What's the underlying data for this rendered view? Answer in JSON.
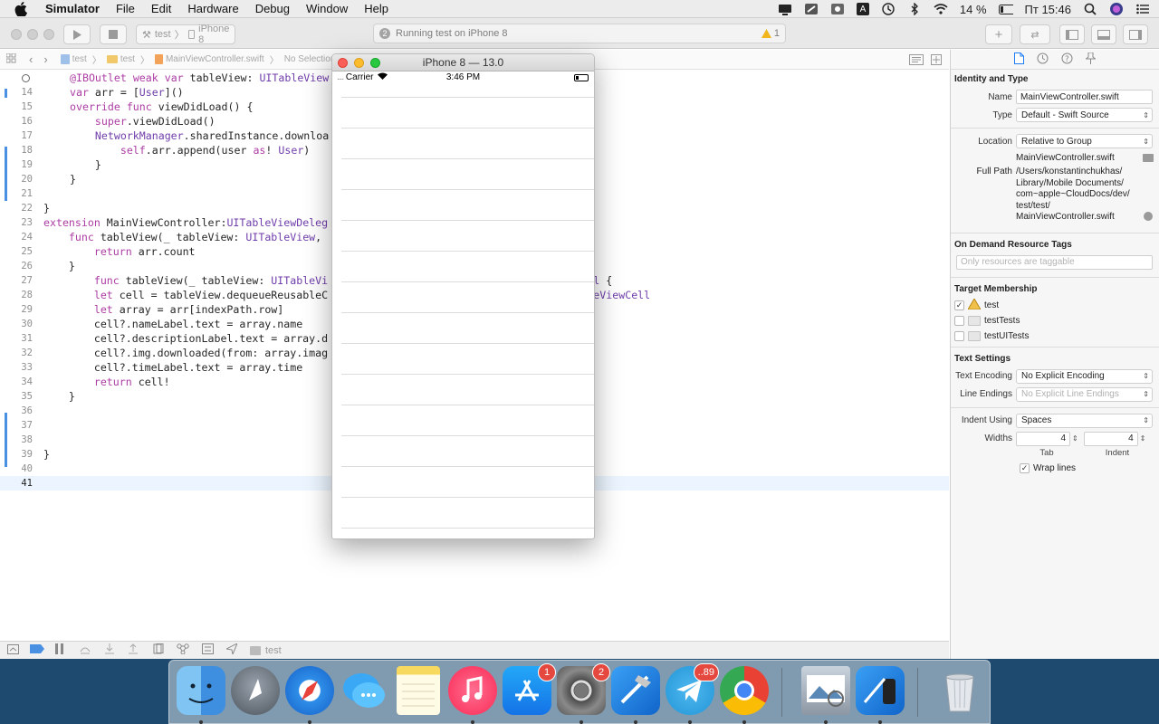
{
  "menubar": {
    "app_name": "Simulator",
    "items": [
      "File",
      "Edit",
      "Hardware",
      "Debug",
      "Window",
      "Help"
    ],
    "battery": "14 %",
    "clock": "Пт 15:46",
    "input_source": "A"
  },
  "toolbar": {
    "scheme_target": "test",
    "scheme_device": "iPhone 8",
    "activity_count": "2",
    "activity_text": "Running test on iPhone 8",
    "warning_count": "1"
  },
  "jumpbar": {
    "project": "test",
    "folder": "test",
    "file": "MainViewController.swift",
    "selection": "No Selection"
  },
  "editor": {
    "lines": [
      {
        "num": "",
        "code": "@IBOutlet weak var tableView: UITableView!"
      },
      {
        "num": "14",
        "code": "var arr = [User]()"
      },
      {
        "num": "15",
        "code": "override func viewDidLoad() {"
      },
      {
        "num": "16",
        "code": "    super.viewDidLoad()"
      },
      {
        "num": "17",
        "code": "    NetworkManager.sharedInstance.downloa"
      },
      {
        "num": "18",
        "code": "        self.arr.append(user as! User)"
      },
      {
        "num": "19",
        "code": "    }"
      },
      {
        "num": "20",
        "code": "}"
      },
      {
        "num": "21",
        "code": ""
      },
      {
        "num": "22",
        "code": "}"
      },
      {
        "num": "23",
        "code": "extension MainViewController:UITableViewDeleg"
      },
      {
        "num": "24",
        "code": "    func tableView(_ tableView: UITableView,                                 nt {"
      },
      {
        "num": "25",
        "code": "        return arr.count"
      },
      {
        "num": "26",
        "code": "    }"
      },
      {
        "num": "27",
        "code": "        func tableView(_ tableView: UITableVi                          > UITableViewCell {"
      },
      {
        "num": "28",
        "code": "        let cell = tableView.dequeueReusableC                          th) as? MainTableViewCell"
      },
      {
        "num": "29",
        "code": "        let array = arr[indexPath.row]"
      },
      {
        "num": "30",
        "code": "        cell?.nameLabel.text = array.name"
      },
      {
        "num": "31",
        "code": "        cell?.descriptionLabel.text = array.d"
      },
      {
        "num": "32",
        "code": "        cell?.img.downloaded(from: array.imag"
      },
      {
        "num": "33",
        "code": "        cell?.timeLabel.text = array.time"
      },
      {
        "num": "34",
        "code": "        return cell!"
      },
      {
        "num": "35",
        "code": "    }"
      },
      {
        "num": "36",
        "code": ""
      },
      {
        "num": "37",
        "code": ""
      },
      {
        "num": "38",
        "code": ""
      },
      {
        "num": "39",
        "code": "}"
      },
      {
        "num": "40",
        "code": ""
      },
      {
        "num": "41",
        "code": ""
      }
    ]
  },
  "debugbar": {
    "target": "test"
  },
  "inspector": {
    "identity_title": "Identity and Type",
    "name_label": "Name",
    "name_value": "MainViewController.swift",
    "type_label": "Type",
    "type_value": "Default - Swift Source",
    "location_label": "Location",
    "location_value": "Relative to Group",
    "location_file": "MainViewController.swift",
    "fullpath_label": "Full Path",
    "fullpath_lines": [
      "/Users/konstantinchukhas/",
      "Library/Mobile Documents/",
      "com~apple~CloudDocs/dev/",
      "test/test/",
      "MainViewController.swift"
    ],
    "odr_title": "On Demand Resource Tags",
    "odr_placeholder": "Only resources are taggable",
    "target_title": "Target Membership",
    "targets": [
      {
        "name": "test",
        "checked": "✓"
      },
      {
        "name": "testTests",
        "checked": ""
      },
      {
        "name": "testUITests",
        "checked": ""
      }
    ],
    "text_title": "Text Settings",
    "encoding_label": "Text Encoding",
    "encoding_value": "No Explicit Encoding",
    "endings_label": "Line Endings",
    "endings_value": "No Explicit Line Endings",
    "indent_label": "Indent Using",
    "indent_value": "Spaces",
    "widths_label": "Widths",
    "tab_value": "4",
    "tab_caption": "Tab",
    "indent_width_value": "4",
    "indent_caption": "Indent",
    "wrap_label": "Wrap lines",
    "wrap_checked": "✓"
  },
  "simulator": {
    "title": "iPhone 8 — 13.0",
    "carrier": "Carrier",
    "time": "3:46 PM"
  },
  "dock": {
    "badges": {
      "appstore": "1",
      "preferences": "2",
      "telegram": "..89"
    }
  },
  "colors": {
    "keyword": "#ad3da4",
    "type": "#703daa",
    "current_line": "#ecf5ff",
    "change_bar": "#4a90e2",
    "badge": "#e5483f"
  }
}
